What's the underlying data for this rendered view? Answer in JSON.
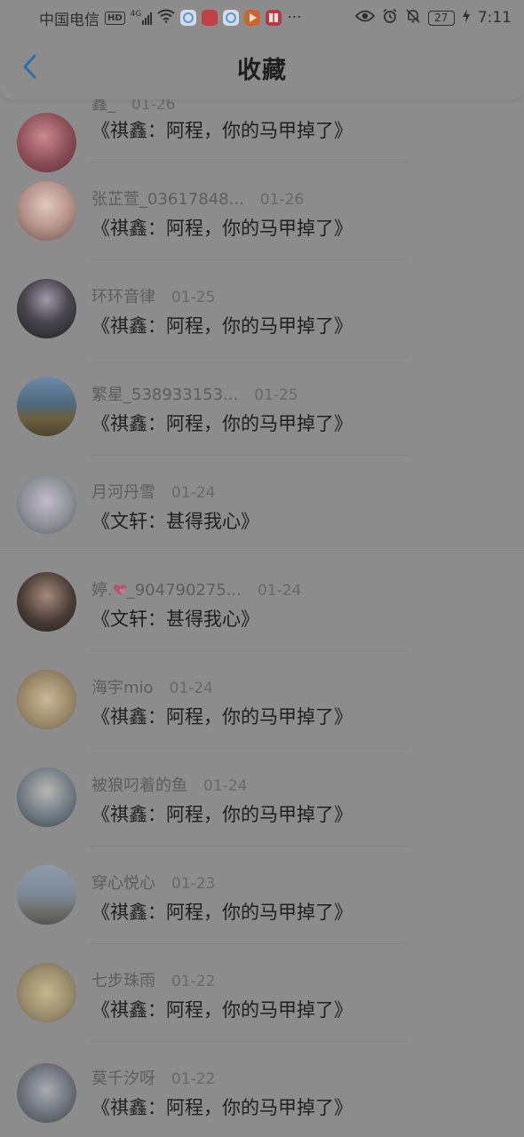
{
  "status_bar": {
    "carrier": "中国电信",
    "hd_badge": "HD",
    "signal_type": "4G",
    "battery_level": "27",
    "time": "7:11",
    "more_dots": "···"
  },
  "header": {
    "title": "收藏"
  },
  "items": [
    {
      "username": "鑫_",
      "date": "01-26",
      "title": "《祺鑫：阿程，你的马甲掉了》",
      "avatar_color": "#8a4c55"
    },
    {
      "username": "张芷萱_03617848...",
      "date": "01-26",
      "title": "《祺鑫：阿程，你的马甲掉了》",
      "avatar_color": "#b5948a"
    },
    {
      "username": "环环音律",
      "date": "01-25",
      "title": "《祺鑫：阿程，你的马甲掉了》",
      "avatar_color": "#3b3b3f"
    },
    {
      "username": "繁星_538933153...",
      "date": "01-25",
      "title": "《祺鑫：阿程，你的马甲掉了》",
      "avatar_color": "#5b6a7a"
    },
    {
      "username": "月河丹雪",
      "date": "01-24",
      "title": "《文轩：甚得我心》",
      "avatar_color": "#8f8f96"
    },
    {
      "username_prefix": "婷.",
      "username_suffix": "_904790275...",
      "date": "01-24",
      "title": "《文轩：甚得我心》",
      "avatar_color": "#4a3d38"
    },
    {
      "username": "海宇mio",
      "date": "01-24",
      "title": "《祺鑫：阿程，你的马甲掉了》",
      "avatar_color": "#9c8a6a"
    },
    {
      "username": "被狼叼着的鱼",
      "date": "01-24",
      "title": "《祺鑫：阿程，你的马甲掉了》",
      "avatar_color": "#6f7a82"
    },
    {
      "username": "穿心悦心",
      "date": "01-23",
      "title": "《祺鑫：阿程，你的马甲掉了》",
      "avatar_color": "#7d8896"
    },
    {
      "username": "七步珠雨",
      "date": "01-22",
      "title": "《祺鑫：阿程，你的马甲掉了》",
      "avatar_color": "#9a8e6d"
    },
    {
      "username": "莫千汐呀",
      "date": "01-22",
      "title": "《祺鑫：阿程，你的马甲掉了》",
      "avatar_color": "#6d7179"
    }
  ],
  "icons": {
    "back": "chevron-left-icon",
    "eye": "eye-icon",
    "alarm": "alarm-icon",
    "mute": "bell-off-icon",
    "charging": "lightning-icon",
    "wifi": "wifi-icon",
    "signal": "signal-icon",
    "emoji": "heart-icon"
  },
  "colors": {
    "overlay_background": "#8c8c8c",
    "accent_back": "#2a6fa8"
  }
}
